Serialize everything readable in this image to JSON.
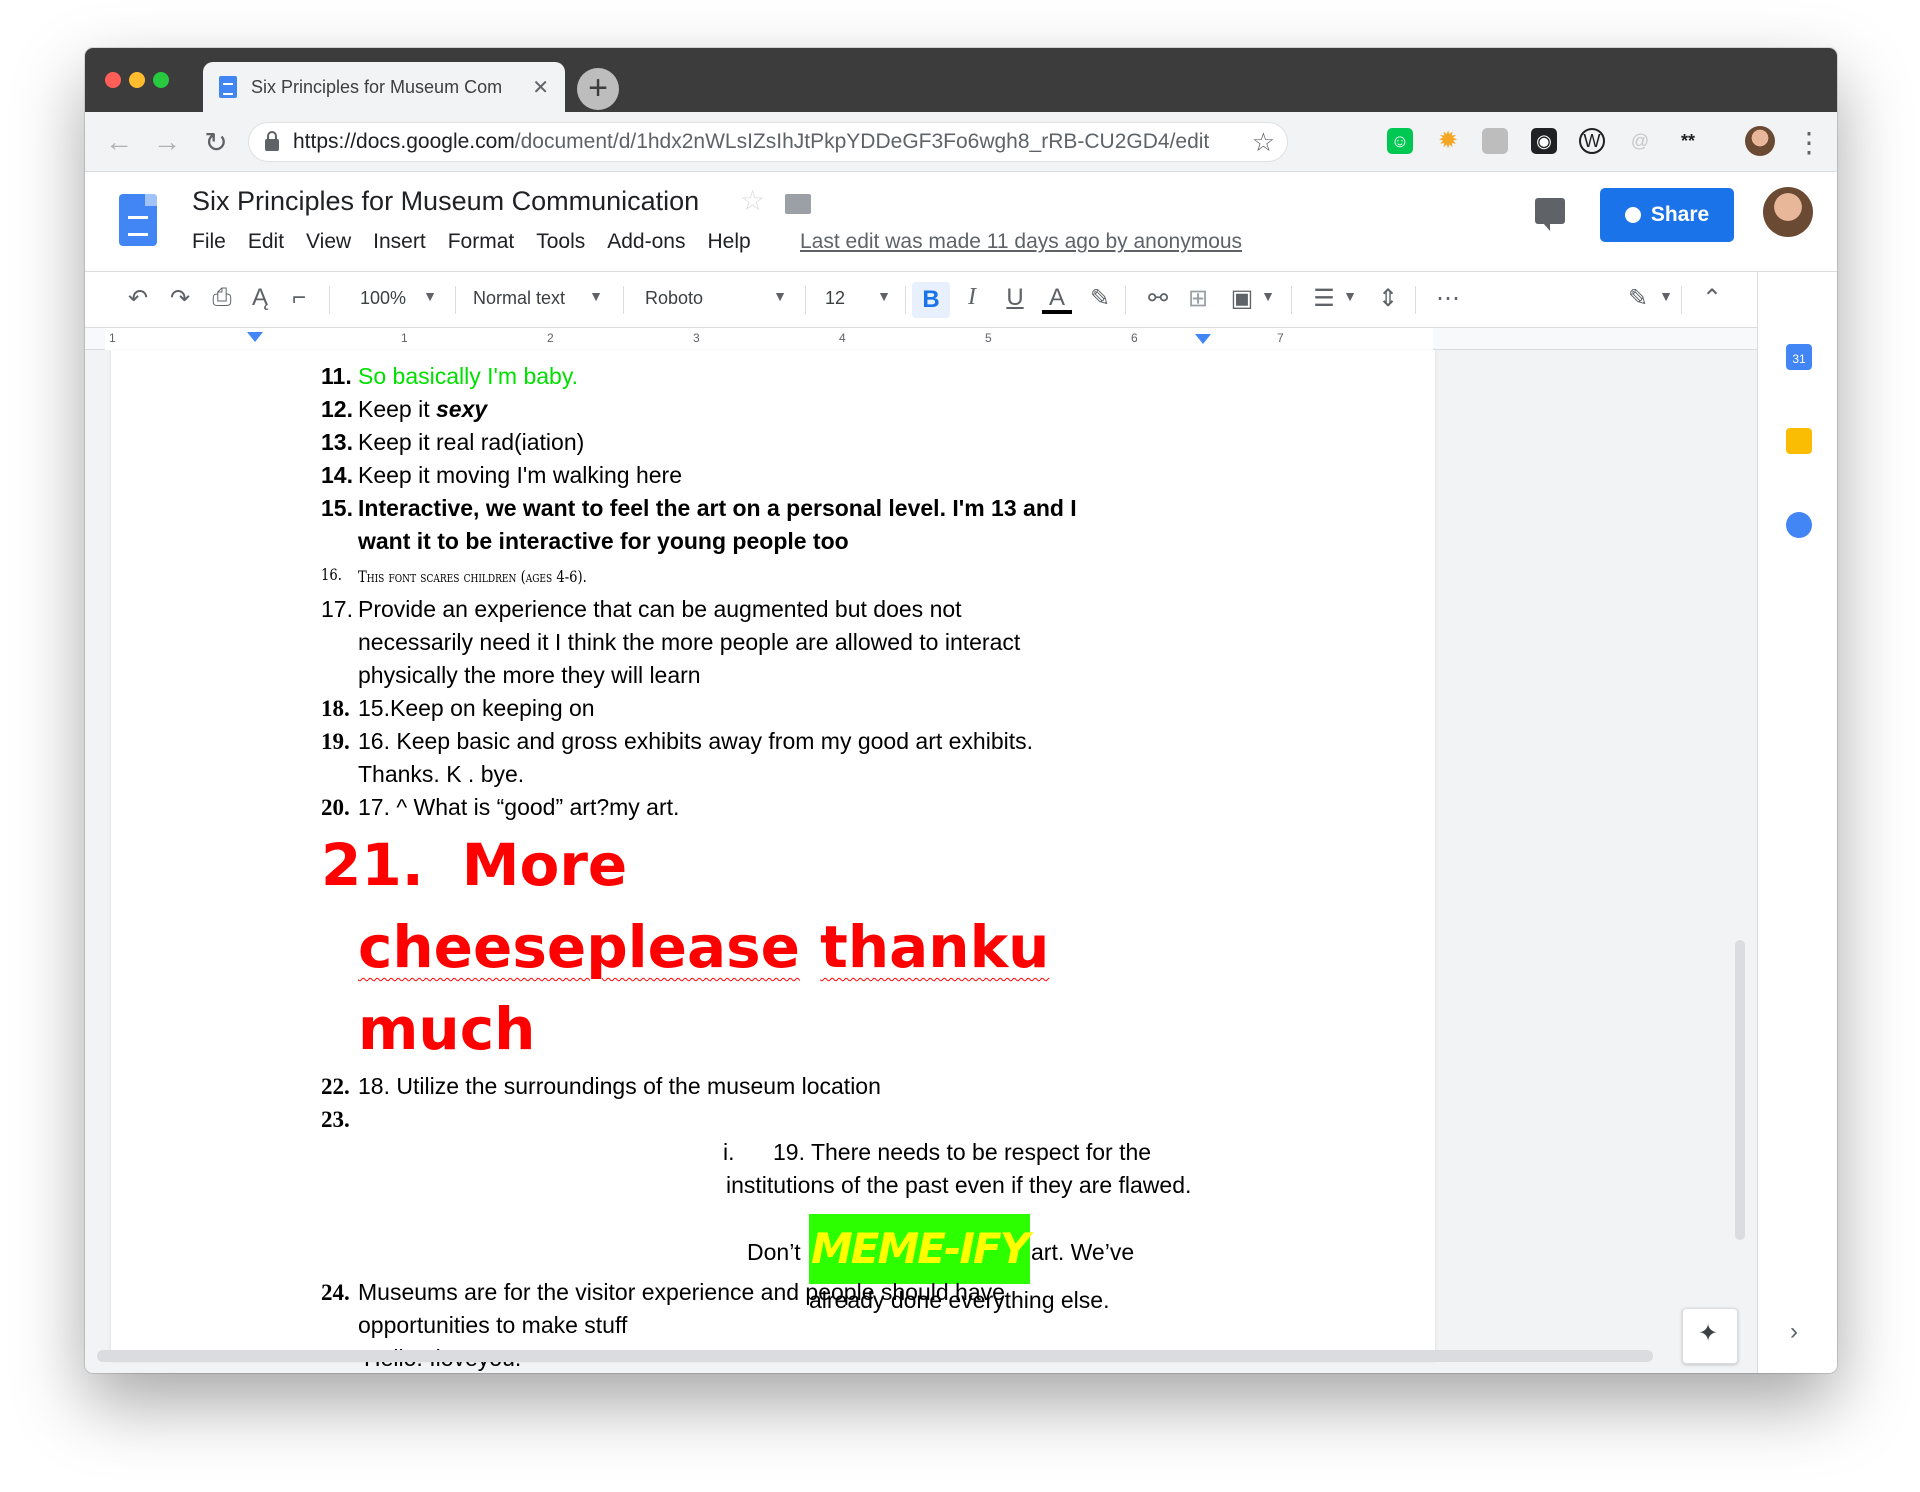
{
  "browser": {
    "tab_title": "Six Principles for Museum Com",
    "tab_close": "✕",
    "new_tab": "+",
    "url_host": "https://docs.google.com",
    "url_path": "/document/d/1hdx2nWLsIZsIhJtPkpYDDeGF3Fo6wgh8_rRB-CU2GD4/edit"
  },
  "docs": {
    "title": "Six Principles for Museum Communication",
    "menu": [
      "File",
      "Edit",
      "View",
      "Insert",
      "Format",
      "Tools",
      "Add-ons",
      "Help"
    ],
    "last_edit": "Last edit was made 11 days ago by anonymous",
    "share_label": "Share"
  },
  "format_toolbar": {
    "zoom": "100%",
    "style": "Normal text",
    "font": "Roboto",
    "size": "12",
    "bold": "B",
    "italic": "I",
    "underline": "U",
    "text_color": "A"
  },
  "ruler": [
    "1",
    "1",
    "2",
    "3",
    "4",
    "5",
    "6",
    "7"
  ],
  "document": {
    "items": [
      {
        "n": "11.",
        "text": "So basically I'm baby."
      },
      {
        "n": "12.",
        "text": "Keep it ",
        "emph": "sexy"
      },
      {
        "n": "13.",
        "text": "Keep it real rad(iation)"
      },
      {
        "n": "14.",
        "text": "Keep it moving I'm walking here"
      },
      {
        "n": "15.",
        "text": "Interactive, we want to feel the art on a personal level. I'm 13 and I want it to be interactive for young people too"
      },
      {
        "n": "16.",
        "text": "This font scares children (ages 4-6)."
      },
      {
        "n": "17.",
        "text": "Provide an experience that can be augmented but does not necessarily need it I think the more people are allowed to interact physically the more they will learn"
      },
      {
        "n": "18.",
        "text": "15.Keep on keeping on"
      },
      {
        "n": "19.",
        "text": "16. Keep basic and gross exhibits away from my good art exhibits. Thanks. K . bye."
      },
      {
        "n": "20.",
        "text": "17. ^ What is “good” art?my art."
      },
      {
        "n": "21.",
        "big_1": "More ",
        "big_2": "cheeseplease",
        "big_3": "thanku",
        "big_4": "much"
      },
      {
        "n": "22.",
        "text": "18. Utilize the surroundings of the museum location"
      },
      {
        "n": "23.",
        "text": ""
      },
      {
        "sub_n": "i.",
        "line1": "19. There needs to be respect for the",
        "line2": "institutions of the past even if they are flawed.",
        "dont": "Don’t",
        "meme": "MEME-IFY",
        "after_meme": "art. We’ve",
        "line4": "already done everything else."
      },
      {
        "n": "24.",
        "text": "Museums are for the visitor experience and people should have opportunities to make stuff"
      },
      {
        "text": "Hello. Iloveyou."
      }
    ]
  },
  "colors": {
    "share_blue": "#1a73e8",
    "item11_green": "#00e000",
    "big_red": "#ff0000",
    "meme_bg": "#2cff00",
    "meme_fg": "#ffff00"
  }
}
